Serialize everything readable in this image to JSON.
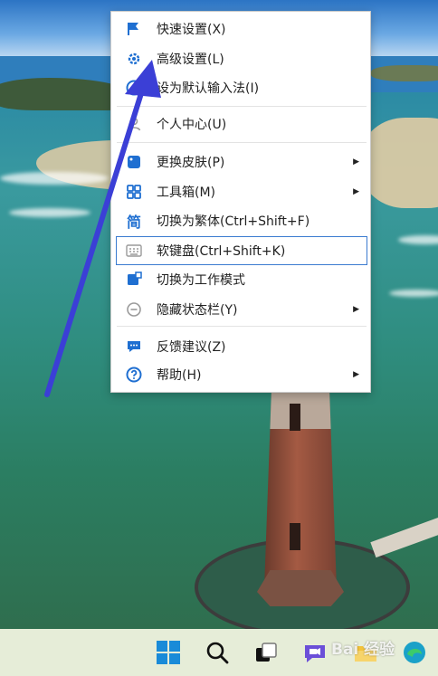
{
  "menu": {
    "items": [
      {
        "label": "快速设置(X)",
        "icon": "flag-icon",
        "submenu": false
      },
      {
        "label": "高级设置(L)",
        "icon": "gear-icon",
        "submenu": false
      },
      {
        "label": "设为默认输入法(I)",
        "icon": "check-circle-icon",
        "submenu": false
      },
      {
        "label": "个人中心(U)",
        "icon": "user-icon",
        "submenu": false
      },
      {
        "label": "更换皮肤(P)",
        "icon": "palette-icon",
        "submenu": true
      },
      {
        "label": "工具箱(M)",
        "icon": "toolbox-grid-icon",
        "submenu": true
      },
      {
        "label": "切换为繁体(Ctrl+Shift+F)",
        "icon": "traditional-chinese-icon",
        "icon_glyph": "简",
        "submenu": false
      },
      {
        "label": "软键盘(Ctrl+Shift+K)",
        "icon": "keyboard-icon",
        "submenu": false,
        "highlighted": true
      },
      {
        "label": "切换为工作模式",
        "icon": "work-mode-icon",
        "submenu": false
      },
      {
        "label": "隐藏状态栏(Y)",
        "icon": "minus-circle-icon",
        "submenu": true
      },
      {
        "label": "反馈建议(Z)",
        "icon": "feedback-icon",
        "submenu": false
      },
      {
        "label": "帮助(H)",
        "icon": "help-icon",
        "submenu": true
      }
    ],
    "accent_color": "#1f6fd1",
    "arrow_color": "#3b3fd6"
  },
  "taskbar": {
    "icons": [
      "windows-start-icon",
      "search-icon",
      "task-view-icon",
      "chat-icon",
      "file-explorer-icon",
      "edge-icon"
    ]
  },
  "watermark": "Bai 经验"
}
